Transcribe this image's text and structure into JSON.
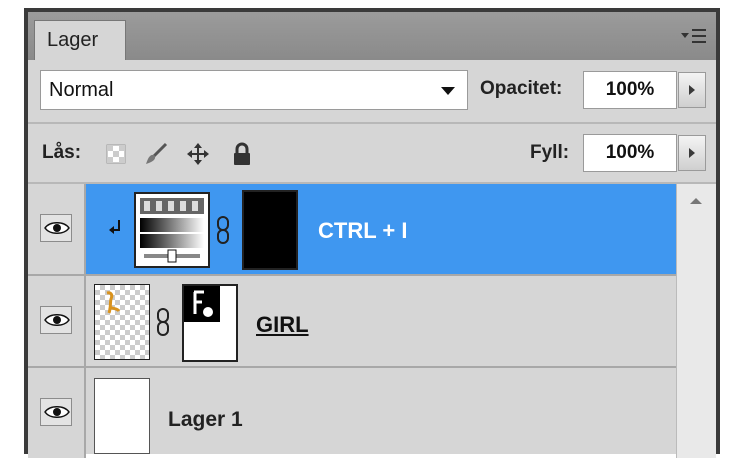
{
  "panel": {
    "tab_label": "Lager",
    "menu_icon": "panel-menu-icon"
  },
  "blend": {
    "mode": "Normal",
    "opacity_label": "Opacitet:",
    "opacity_value": "100%"
  },
  "lock": {
    "label": "Lås:",
    "icons": [
      "lock-transparent-pixels-icon",
      "lock-image-pixels-icon",
      "lock-position-icon",
      "lock-all-icon"
    ],
    "fill_label": "Fyll:",
    "fill_value": "100%"
  },
  "layers": [
    {
      "name": "CTRL + I",
      "selected": true,
      "visible": true,
      "type": "adjustment-clipped"
    },
    {
      "name": "GIRL",
      "selected": false,
      "visible": true,
      "type": "masked"
    },
    {
      "name": "Lager 1",
      "selected": false,
      "visible": true,
      "type": "normal"
    }
  ],
  "colors": {
    "selection": "#3f97f0",
    "panel_bg": "#d6d6d6"
  }
}
